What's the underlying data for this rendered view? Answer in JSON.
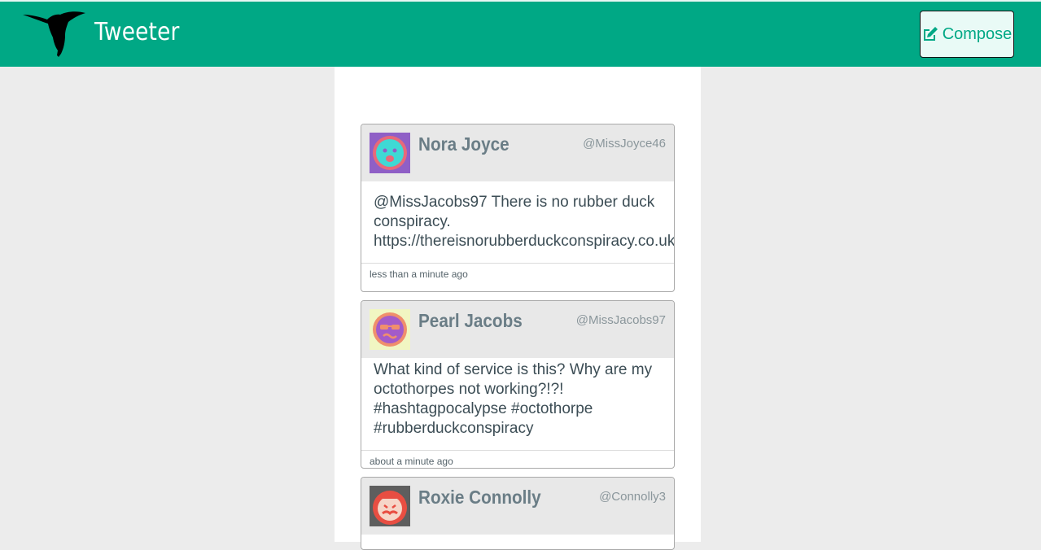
{
  "navbar": {
    "brand": "Tweeter",
    "logo_icon": "hummingbird-icon",
    "compose_label": "Compose",
    "compose_icon": "edit-icon",
    "color": "#00a885"
  },
  "tweets": [
    {
      "name": "Nora Joyce",
      "handle": "@MissJoyce46",
      "text_lines": [
        "@MissJacobs97 There is no rubber duck",
        "conspiracy.",
        "https://thereisnorubberduckconspiracy.co.uk"
      ],
      "time": "less than a minute ago",
      "avatar_icon": "smiley-avatar-icon"
    },
    {
      "name": "Pearl Jacobs",
      "handle": "@MissJacobs97",
      "text_lines": [
        "What kind of service is this? Why are my",
        "octothorpes not working?!?!",
        "#hashtagpocalypse #octothorpe",
        "#rubberduckconspiracy"
      ],
      "time": "about a minute ago",
      "avatar_icon": "sunglasses-avatar-icon"
    },
    {
      "name": "Roxie Connolly",
      "handle": "@Connolly3",
      "avatar_icon": "mustache-avatar-icon"
    }
  ]
}
